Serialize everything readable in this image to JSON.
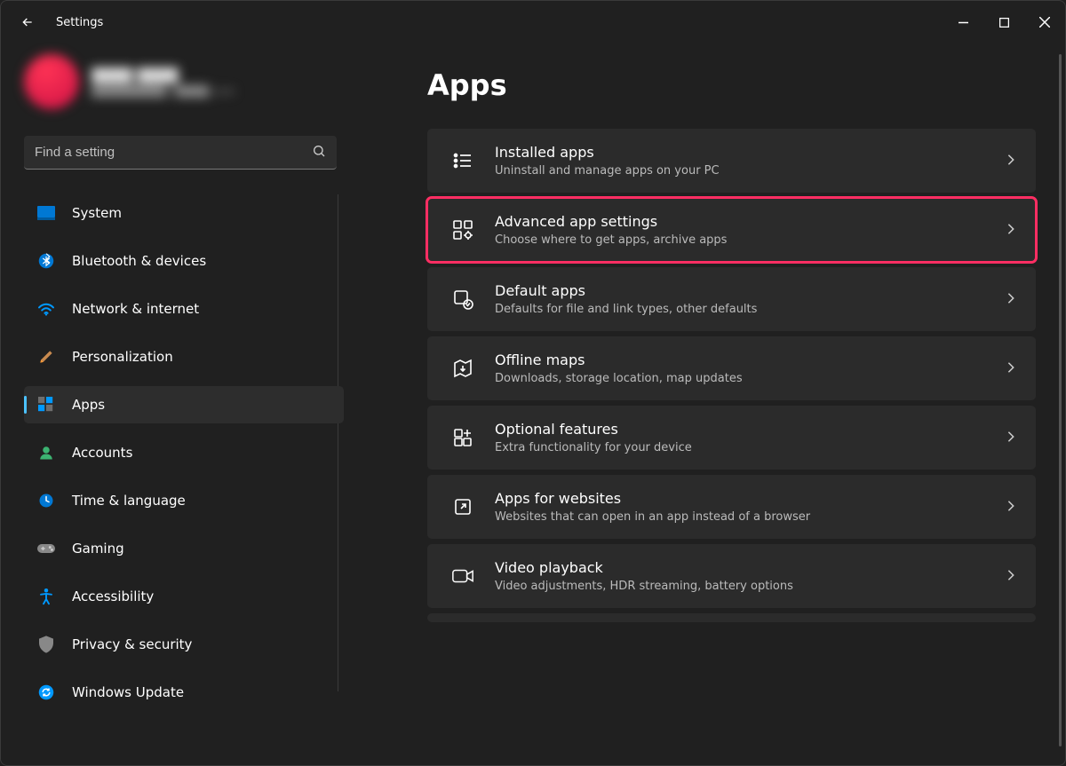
{
  "titlebar": {
    "title": "Settings"
  },
  "search": {
    "placeholder": "Find a setting"
  },
  "profile": {
    "name": "████ ████",
    "email": "█████████@████.com"
  },
  "nav": [
    {
      "id": "system",
      "label": "System"
    },
    {
      "id": "bluetooth",
      "label": "Bluetooth & devices"
    },
    {
      "id": "network",
      "label": "Network & internet"
    },
    {
      "id": "personalization",
      "label": "Personalization"
    },
    {
      "id": "apps",
      "label": "Apps",
      "active": true
    },
    {
      "id": "accounts",
      "label": "Accounts"
    },
    {
      "id": "time",
      "label": "Time & language"
    },
    {
      "id": "gaming",
      "label": "Gaming"
    },
    {
      "id": "accessibility",
      "label": "Accessibility"
    },
    {
      "id": "privacy",
      "label": "Privacy & security"
    },
    {
      "id": "update",
      "label": "Windows Update"
    }
  ],
  "page": {
    "title": "Apps"
  },
  "cards": [
    {
      "id": "installed",
      "title": "Installed apps",
      "sub": "Uninstall and manage apps on your PC",
      "highlight": false
    },
    {
      "id": "advanced",
      "title": "Advanced app settings",
      "sub": "Choose where to get apps, archive apps",
      "highlight": true
    },
    {
      "id": "default",
      "title": "Default apps",
      "sub": "Defaults for file and link types, other defaults",
      "highlight": false
    },
    {
      "id": "offline",
      "title": "Offline maps",
      "sub": "Downloads, storage location, map updates",
      "highlight": false
    },
    {
      "id": "optional",
      "title": "Optional features",
      "sub": "Extra functionality for your device",
      "highlight": false
    },
    {
      "id": "websites",
      "title": "Apps for websites",
      "sub": "Websites that can open in an app instead of a browser",
      "highlight": false
    },
    {
      "id": "video",
      "title": "Video playback",
      "sub": "Video adjustments, HDR streaming, battery options",
      "highlight": false
    }
  ]
}
